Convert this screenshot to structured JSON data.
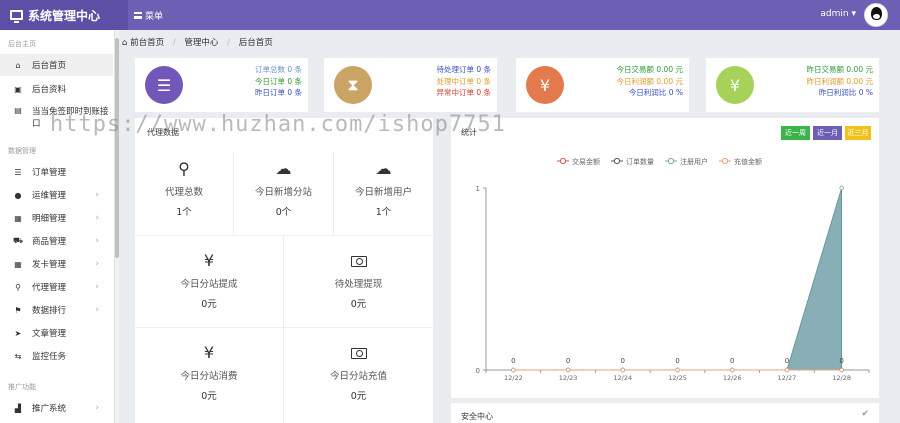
{
  "header": {
    "title": "系统管理中心",
    "menu_label": "菜单",
    "user_name": "admin"
  },
  "sidebar": {
    "section_main": "后台主页",
    "section_data": "数据管理",
    "section_promo": "推广功能",
    "items": [
      {
        "label": "后台首页",
        "icon": "home-icon",
        "glyph": "⌂"
      },
      {
        "label": "后台资料",
        "icon": "id-card-icon",
        "glyph": "▣"
      },
      {
        "label": "当当免签即时到账接口",
        "icon": "document-icon",
        "glyph": "▤"
      },
      {
        "label": "订单管理",
        "icon": "list-icon",
        "glyph": "☰"
      },
      {
        "label": "运维管理",
        "icon": "comments-icon",
        "glyph": "●"
      },
      {
        "label": "明细管理",
        "icon": "calendar-icon",
        "glyph": "▦"
      },
      {
        "label": "商品管理",
        "icon": "cart-icon",
        "glyph": "⛟"
      },
      {
        "label": "发卡管理",
        "icon": "grid-icon",
        "glyph": "▦"
      },
      {
        "label": "代理管理",
        "icon": "sitemap-icon",
        "glyph": "⚲"
      },
      {
        "label": "数据排行",
        "icon": "flag-icon",
        "glyph": "⚑"
      },
      {
        "label": "文章管理",
        "icon": "send-icon",
        "glyph": "➤"
      },
      {
        "label": "监控任务",
        "icon": "retweet-icon",
        "glyph": "⇆"
      },
      {
        "label": "推广系统",
        "icon": "bar-chart-icon",
        "glyph": "▟"
      }
    ]
  },
  "breadcrumb": [
    "前台首页",
    "管理中心",
    "后台首页"
  ],
  "stats": [
    {
      "lines": [
        {
          "label": "订单总数",
          "value": "0 条",
          "color": "#6a8fc9"
        },
        {
          "label": "今日订单",
          "value": "0 条",
          "color": "#2e9a3a"
        },
        {
          "label": "昨日订单",
          "value": "0 条",
          "color": "#3a4fc0"
        }
      ],
      "color": "#7158b8",
      "icon": "list-icon",
      "glyph": "☰"
    },
    {
      "lines": [
        {
          "label": "待处理订单",
          "value": "0 条",
          "color": "#3a4fc0"
        },
        {
          "label": "处理中订单",
          "value": "0 条",
          "color": "#e09b2a"
        },
        {
          "label": "异常中订单",
          "value": "0 条",
          "color": "#d23a2a"
        }
      ],
      "color": "#c9a464",
      "icon": "hourglass-icon",
      "glyph": "⧗"
    },
    {
      "lines": [
        {
          "label": "今日交易额",
          "value": "0.00 元",
          "color": "#2e9a3a"
        },
        {
          "label": "今日利润额",
          "value": "0.00 元",
          "color": "#e09b2a"
        },
        {
          "label": "今日利润比",
          "value": "0 %",
          "color": "#3a4fc0"
        }
      ],
      "color": "#e27a4e",
      "icon": "yen-icon",
      "glyph": "¥"
    },
    {
      "lines": [
        {
          "label": "昨日交易额",
          "value": "0.00 元",
          "color": "#2e9a3a"
        },
        {
          "label": "昨日利润额",
          "value": "0.00 元",
          "color": "#e09b2a"
        },
        {
          "label": "昨日利润比",
          "value": "0 %",
          "color": "#3a4fc0"
        }
      ],
      "color": "#a6d25a",
      "icon": "yen-icon",
      "glyph": "¥"
    }
  ],
  "watermark": "https://www.huzhan.com/ishop7751",
  "overview": {
    "title": "代理数据",
    "cells": [
      {
        "label": "代理总数",
        "value": "1个",
        "icon": "sitemap-icon",
        "glyph": "⚲"
      },
      {
        "label": "今日新增分站",
        "value": "0个",
        "icon": "cloud-icon",
        "glyph": "☁"
      },
      {
        "label": "今日新增用户",
        "value": "1个",
        "icon": "cloud-icon",
        "glyph": "☁"
      },
      {
        "label": "今日分站提成",
        "value": "0元",
        "icon": "yen-icon",
        "glyph": "¥"
      },
      {
        "label": "待处理提现",
        "value": "0元",
        "icon": "money-icon",
        "glyph": ""
      },
      {
        "label": "今日分站消费",
        "value": "0元",
        "icon": "yen-icon",
        "glyph": "¥"
      },
      {
        "label": "今日分站充值",
        "value": "0元",
        "icon": "money-icon",
        "glyph": ""
      }
    ]
  },
  "chart_panel": {
    "title": "统计",
    "buttons": [
      {
        "label": "近一周",
        "color": "#3bb44a"
      },
      {
        "label": "近一月",
        "color": "#6d5fb4"
      },
      {
        "label": "近三月",
        "color": "#f2c21c"
      }
    ]
  },
  "chart_data": {
    "type": "line",
    "x": [
      "12/22",
      "12/23",
      "12/24",
      "12/25",
      "12/26",
      "12/27",
      "12/28"
    ],
    "ylim": [
      0,
      1
    ],
    "yticks": [
      "0",
      "1"
    ],
    "grid": true,
    "legend_position": "top",
    "series": [
      {
        "name": "交易金额",
        "values": [
          0,
          0,
          0,
          0,
          0,
          0,
          0
        ],
        "color": "#d9534f",
        "labels": [
          "0",
          "0",
          "0",
          "0",
          "0",
          "0",
          "0"
        ]
      },
      {
        "name": "订单数量",
        "values": [
          0,
          0,
          0,
          0,
          0,
          0,
          0
        ],
        "color": "#555555"
      },
      {
        "name": "注册用户",
        "values": [
          0,
          0,
          0,
          0,
          0,
          0,
          1
        ],
        "color": "#7aa6ad",
        "area": true
      },
      {
        "name": "充值金额",
        "values": [
          0,
          0,
          0,
          0,
          0,
          0,
          0
        ],
        "color": "#e8a07a"
      }
    ]
  },
  "safety_panel": {
    "title": "安全中心",
    "check": "✔"
  }
}
